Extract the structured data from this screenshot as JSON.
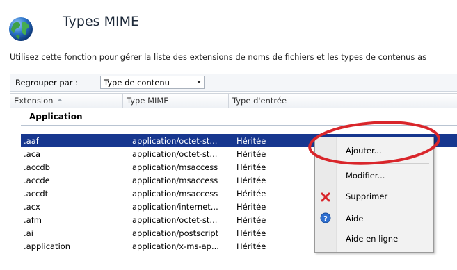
{
  "header": {
    "title": "Types MIME"
  },
  "description": "Utilisez cette fonction pour gérer la liste des extensions de noms de fichiers et les types de contenus as",
  "grouping": {
    "label": "Regrouper par :",
    "value": "Type de contenu"
  },
  "columns": [
    "Extension",
    "Type MIME",
    "Type d'entrée"
  ],
  "group_name": "Application",
  "rows": [
    {
      "ext": ".aaf",
      "mime": "application/octet-st...",
      "entry": "Héritée",
      "selected": true
    },
    {
      "ext": ".aca",
      "mime": "application/octet-st...",
      "entry": "Héritée"
    },
    {
      "ext": ".accdb",
      "mime": "application/msaccess",
      "entry": "Héritée"
    },
    {
      "ext": ".accde",
      "mime": "application/msaccess",
      "entry": "Héritée"
    },
    {
      "ext": ".accdt",
      "mime": "application/msaccess",
      "entry": "Héritée"
    },
    {
      "ext": ".acx",
      "mime": "application/internet...",
      "entry": "Héritée"
    },
    {
      "ext": ".afm",
      "mime": "application/octet-st...",
      "entry": "Héritée"
    },
    {
      "ext": ".ai",
      "mime": "application/postscript",
      "entry": "Héritée"
    },
    {
      "ext": ".application",
      "mime": "application/x-ms-ap...",
      "entry": "Héritée"
    }
  ],
  "context_menu": {
    "add": "Ajouter...",
    "modify": "Modifier...",
    "delete": "Supprimer",
    "help": "Aide",
    "online_help": "Aide en ligne"
  },
  "colors": {
    "selection": "#17378f",
    "highlight_ellipse": "#d9262b"
  }
}
